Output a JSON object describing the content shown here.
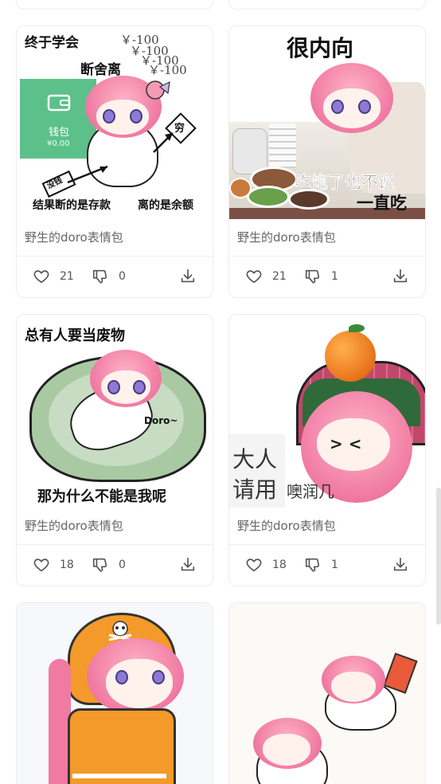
{
  "cards": [
    {
      "title": "野生的doro表情包",
      "likes": "21",
      "dislikes": "0",
      "meme": {
        "top_left": "终于学会",
        "mid": "断舍离",
        "money": [
          "￥-100",
          "￥-100",
          "￥-100",
          "￥-100"
        ],
        "wallet_label": "钱包",
        "wallet_amount": "¥0.00",
        "tag_left": "没钱",
        "tag_right": "穷",
        "bottom_left": "结果断的是存款",
        "bottom_right": "离的是余额"
      }
    },
    {
      "title": "野生的doro表情包",
      "likes": "21",
      "dislikes": "1",
      "meme": {
        "top": "很内向",
        "bottom_line1": "吃饱了也不说",
        "bottom_line2": "一直吃"
      }
    },
    {
      "title": "野生的doro表情包",
      "likes": "18",
      "dislikes": "0",
      "meme": {
        "top": "总有人要当废物",
        "label": "Doro~",
        "bottom": "那为什么不能是我呢"
      }
    },
    {
      "title": "野生的doro表情包",
      "likes": "18",
      "dislikes": "1",
      "meme": {
        "line1": "大人",
        "line2": "请用",
        "line2_small": "噢润几"
      }
    },
    {
      "title": "",
      "meme": {}
    },
    {
      "title": "",
      "meme": {}
    }
  ],
  "colors": {
    "wallet_green": "#5cc08a",
    "doro_pink": "#f07aa2",
    "beanbag_green": "#a9c9a3",
    "orange_hood": "#f39a2a"
  },
  "icons": [
    "heart-icon",
    "thumbs-down-icon",
    "download-icon"
  ]
}
